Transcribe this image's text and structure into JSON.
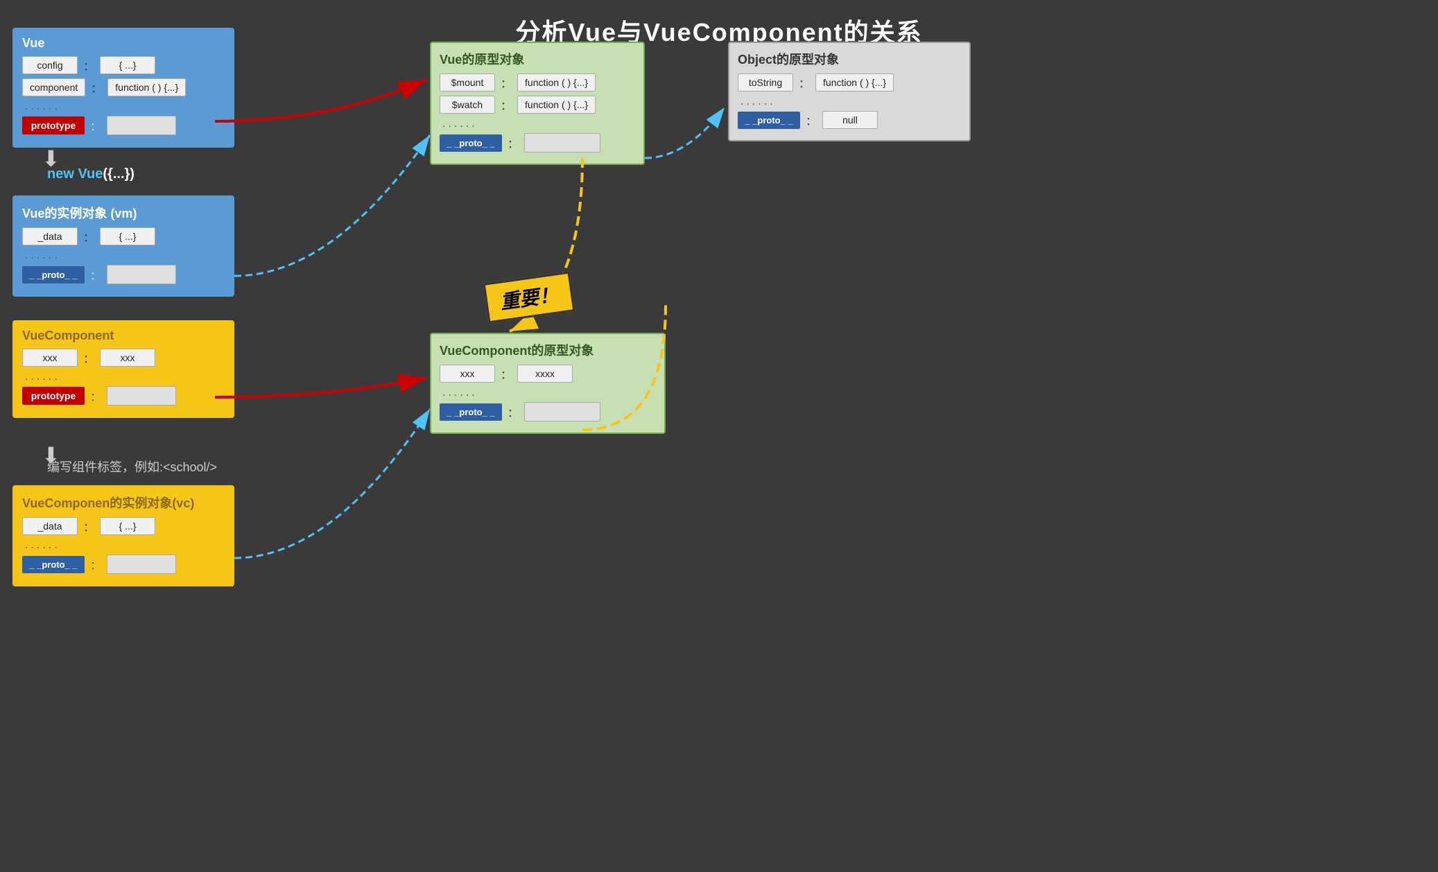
{
  "title": "分析Vue与VueComponent的关系",
  "vue_box": {
    "title": "Vue",
    "rows": [
      {
        "key": "config",
        "colon": "：",
        "value": "{ ...}"
      },
      {
        "key": "component",
        "colon": "：",
        "value": "function ( ) {...}"
      },
      {
        "dots": "......"
      },
      {
        "key_red": "prototype",
        "colon": "：",
        "value_empty": true
      }
    ]
  },
  "vm_box": {
    "title": "Vue的实例对象 (vm)",
    "rows": [
      {
        "key": "_data",
        "colon": "：",
        "value": "{ ...}"
      },
      {
        "dots": "......"
      },
      {
        "key_blue": "_ _proto_ _",
        "colon": "：",
        "value_empty": true
      }
    ]
  },
  "vuecomp_box": {
    "title": "VueComponent",
    "rows": [
      {
        "key": "xxx",
        "colon": "：",
        "value": "xxx"
      },
      {
        "dots": "......"
      },
      {
        "key_red": "prototype",
        "colon": "：",
        "value_empty": true
      }
    ]
  },
  "vc_box": {
    "title": "VueComponen的实例对象(vc)",
    "rows": [
      {
        "key": "_data",
        "colon": "：",
        "value": "{ ...}"
      },
      {
        "dots": "......"
      },
      {
        "key_blue": "_ _proto_ _",
        "colon": "：",
        "value_empty": true
      }
    ]
  },
  "vue_proto_box": {
    "title": "Vue的原型对象",
    "rows": [
      {
        "key": "$mount",
        "colon": "：",
        "value": "function ( ) {...}"
      },
      {
        "key": "$watch",
        "colon": "：",
        "value": "function ( ) {...}"
      },
      {
        "dots": "......"
      },
      {
        "key_blue": "_ _proto_ _",
        "colon": "：",
        "value_empty": true
      }
    ]
  },
  "object_proto_box": {
    "title": "Object的原型对象",
    "rows": [
      {
        "key": "toString",
        "colon": "：",
        "value": "function ( ) {...}"
      },
      {
        "dots": "......"
      },
      {
        "key_blue": "_ _proto_ _",
        "colon": "：",
        "value": "null"
      }
    ]
  },
  "vuecomp_proto_box": {
    "title": "VueComponent的原型对象",
    "rows": [
      {
        "key": "xxx",
        "colon": "：",
        "value": "xxxx"
      },
      {
        "dots": "......"
      },
      {
        "key_blue": "_ _proto_ _",
        "colon": "：",
        "value_empty": true
      }
    ]
  },
  "badge": "重要！",
  "label_new_vue": "new Vue({...})",
  "label_write_tag": "编写组件标签，例如:<school/>"
}
